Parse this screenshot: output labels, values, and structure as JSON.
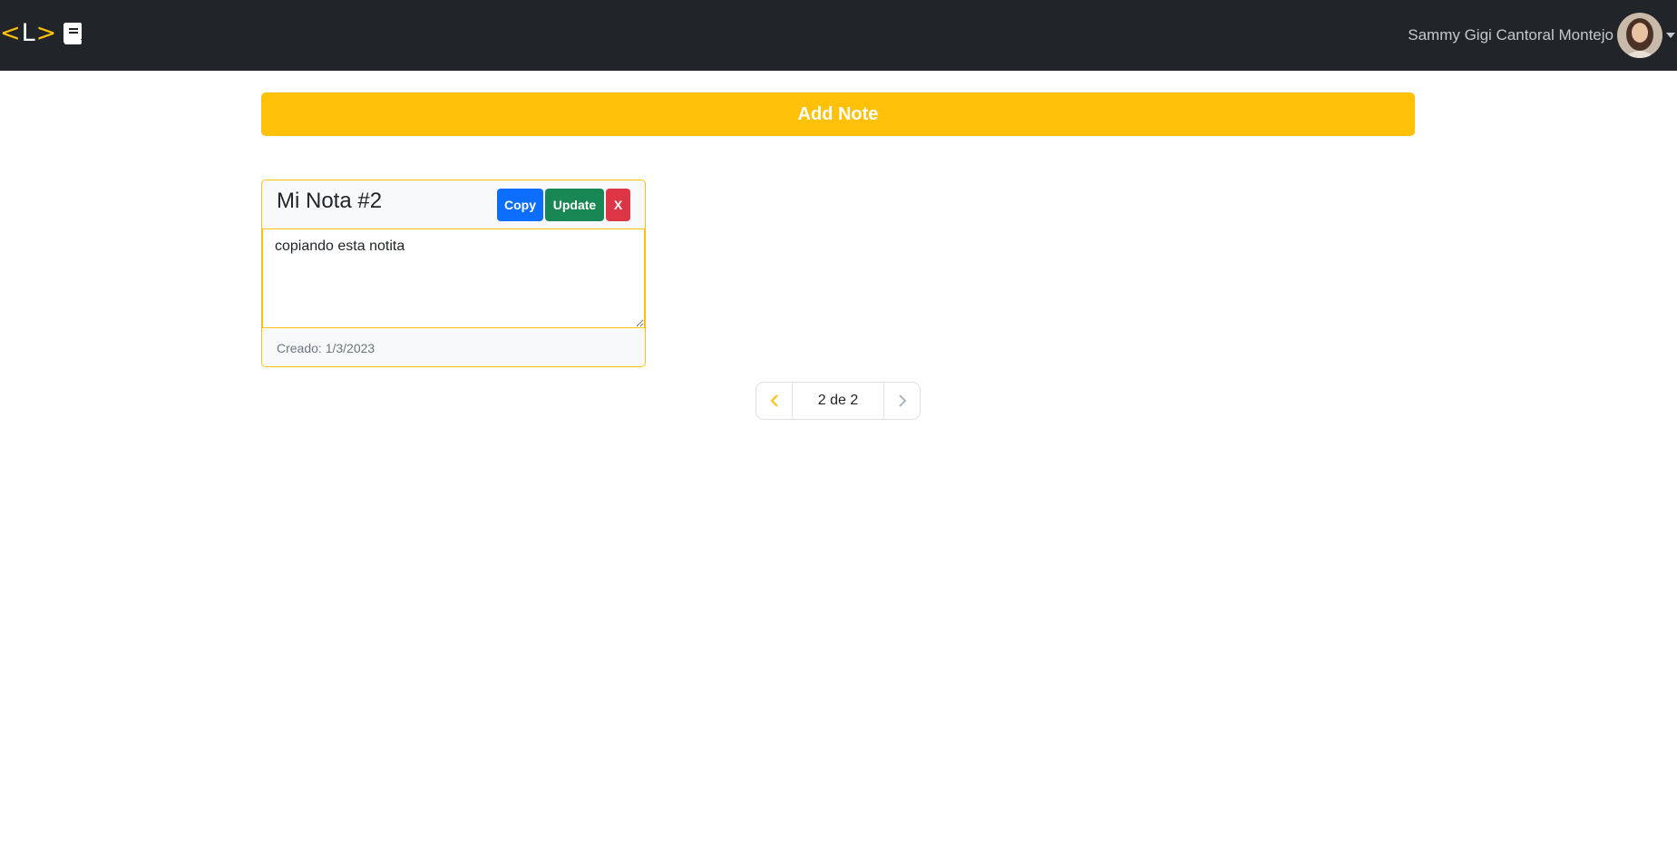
{
  "navbar": {
    "brand": {
      "lt": "<",
      "letter": "L",
      "gt": ">",
      "icon": "book-icon"
    },
    "user": {
      "name": "Sammy Gigi Cantoral Montejo",
      "avatar_icon": "avatar",
      "menu_icon": "caret-down-icon"
    }
  },
  "main": {
    "add_note_label": "Add Note",
    "note": {
      "title": "Mi Nota #2",
      "copy_label": "Copy",
      "update_label": "Update",
      "delete_label": "X",
      "content": "copiando esta notita",
      "created": "Creado: 1/3/2023"
    },
    "pagination": {
      "info": "2 de 2",
      "prev_icon": "chevron-left-icon",
      "next_icon": "chevron-right-icon"
    }
  },
  "colors": {
    "navbar_bg": "#212529",
    "accent": "#ffc107",
    "copy": "#0d6efd",
    "update": "#198754",
    "delete": "#dc3545"
  }
}
